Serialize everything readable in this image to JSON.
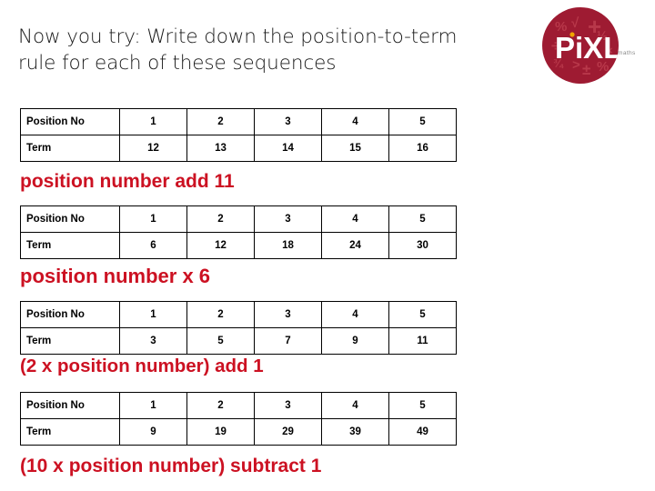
{
  "slide": {
    "title": "Now you try: Write down the position-to-term rule for each of these sequences",
    "accent_red": "#cc1122",
    "logo_red": "#9e1b32"
  },
  "logo": {
    "name": "PiXL",
    "wordmark": "PiXL",
    "subtext": "maths",
    "symbols": [
      "%",
      "√",
      "+",
      "½",
      "÷",
      "−",
      "¾",
      ">",
      "±",
      "%",
      "×"
    ]
  },
  "tables": [
    {
      "id": "table-1",
      "row_labels": [
        "Position No",
        "Term"
      ],
      "positions": [
        "1",
        "2",
        "3",
        "4",
        "5"
      ],
      "terms": [
        "12",
        "13",
        "14",
        "15",
        "16"
      ]
    },
    {
      "id": "table-2",
      "row_labels": [
        "Position No",
        "Term"
      ],
      "positions": [
        "1",
        "2",
        "3",
        "4",
        "5"
      ],
      "terms": [
        "6",
        "12",
        "18",
        "24",
        "30"
      ]
    },
    {
      "id": "table-3",
      "row_labels": [
        "Position No",
        "Term"
      ],
      "positions": [
        "1",
        "2",
        "3",
        "4",
        "5"
      ],
      "terms": [
        "3",
        "5",
        "7",
        "9",
        "11"
      ]
    },
    {
      "id": "table-4",
      "row_labels": [
        "Position No",
        "Term"
      ],
      "positions": [
        "1",
        "2",
        "3",
        "4",
        "5"
      ],
      "terms": [
        "9",
        "19",
        "29",
        "39",
        "49"
      ]
    }
  ],
  "answers": [
    "position number add 11",
    "position number x 6",
    "(2 x position number) add 1",
    "(10 x position number) subtract 1"
  ]
}
